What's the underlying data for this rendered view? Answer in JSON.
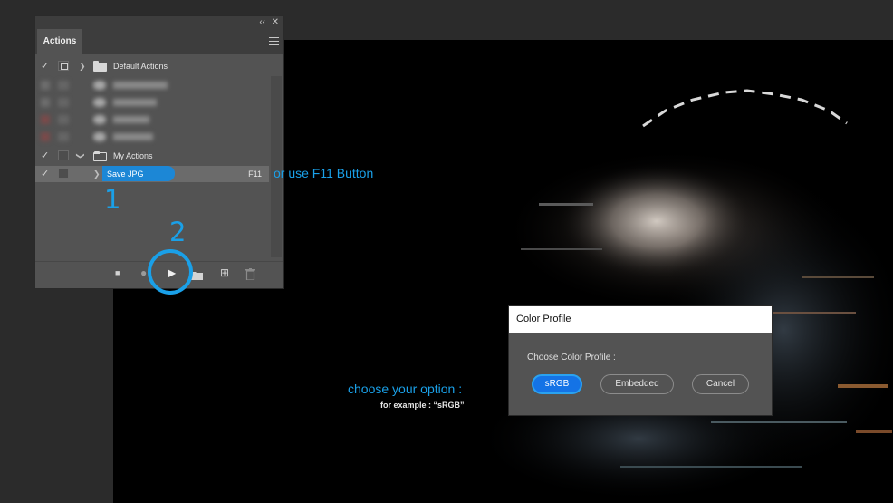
{
  "actions_panel": {
    "tab_label": "Actions",
    "collapse_icon": "double-chevron-left",
    "close_icon": "close-x",
    "menu_icon": "hamburger-menu",
    "rows": [
      {
        "check": "✓",
        "arrow": "❯",
        "label": "Default Actions"
      },
      {
        "check": "✓",
        "arrow": "❯",
        "label": "My Actions"
      },
      {
        "check": "✓",
        "arrow": "❯",
        "label": "Save JPG",
        "shortcut": "F11"
      }
    ],
    "toolbar": {
      "stop": "■",
      "record": "●",
      "play": "▶",
      "new_set": "folder",
      "new_action": "⊞",
      "delete": "trash"
    }
  },
  "annotations": {
    "step1": "1",
    "step2": "2",
    "f11_hint": "or use F11 Button",
    "choose_option": "choose your option :",
    "example": "for example : “sRGB”",
    "accent": "#1aa0e8"
  },
  "dialog": {
    "title": "Color Profile",
    "message": "Choose Color Profile :",
    "buttons": [
      "sRGB",
      "Embedded",
      "Cancel"
    ],
    "selected": "sRGB"
  }
}
